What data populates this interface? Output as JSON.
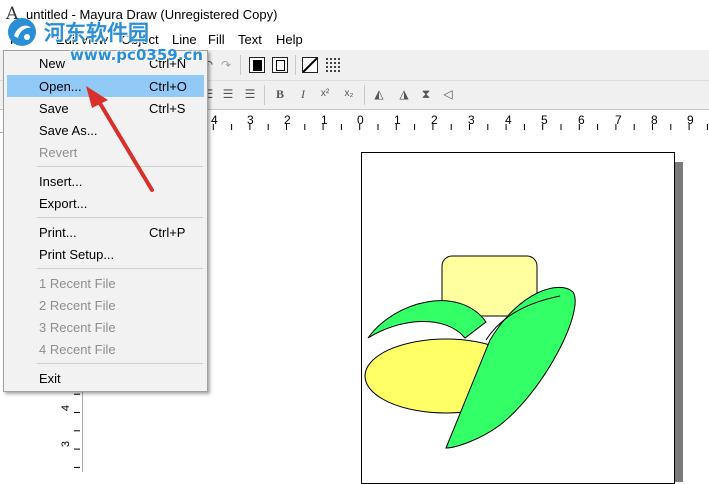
{
  "window": {
    "title": "untitled - Mayura Draw (Unregistered Copy)",
    "app_icon": "A"
  },
  "menubar": {
    "items": [
      "File",
      "Edit",
      "View",
      "Object",
      "Line",
      "Fill",
      "Text",
      "Help"
    ]
  },
  "file_menu": {
    "items": [
      {
        "label": "New",
        "shortcut": "Ctrl+N",
        "enabled": true
      },
      {
        "label": "Open...",
        "shortcut": "Ctrl+O",
        "enabled": true,
        "highlighted": true
      },
      {
        "label": "Save",
        "shortcut": "Ctrl+S",
        "enabled": true
      },
      {
        "label": "Save As...",
        "shortcut": "",
        "enabled": true
      },
      {
        "label": "Revert",
        "shortcut": "",
        "enabled": false
      },
      {
        "label": "Insert...",
        "shortcut": "",
        "enabled": true
      },
      {
        "label": "Export...",
        "shortcut": "",
        "enabled": true
      },
      {
        "label": "Print...",
        "shortcut": "Ctrl+P",
        "enabled": true
      },
      {
        "label": "Print Setup...",
        "shortcut": "",
        "enabled": true
      },
      {
        "label": "1 Recent File",
        "shortcut": "",
        "enabled": false
      },
      {
        "label": "2 Recent File",
        "shortcut": "",
        "enabled": false
      },
      {
        "label": "3 Recent File",
        "shortcut": "",
        "enabled": false
      },
      {
        "label": "4 Recent File",
        "shortcut": "",
        "enabled": false
      },
      {
        "label": "Exit",
        "shortcut": "",
        "enabled": true
      }
    ]
  },
  "ruler": {
    "horizontal_labels": [
      "4",
      "3",
      "2",
      "1",
      "0",
      "1",
      "2",
      "3",
      "4",
      "5",
      "6",
      "7",
      "8",
      "9"
    ],
    "vertical_labels": [
      "4",
      "3"
    ]
  },
  "toolbar": {
    "bold": "B",
    "italic": "I",
    "superscript": "x²",
    "subscript": "x₂"
  },
  "watermark": {
    "text_cn": "河东软件园",
    "url": "www.pc0359.cn"
  },
  "colors": {
    "menu_highlight": "#91c9f7",
    "shape_yellow_light": "#ffffa0",
    "shape_yellow": "#ffff66",
    "shape_green": "#33ff66",
    "arrow_red": "#d9302b",
    "watermark_blue": "#2a8fd6"
  }
}
